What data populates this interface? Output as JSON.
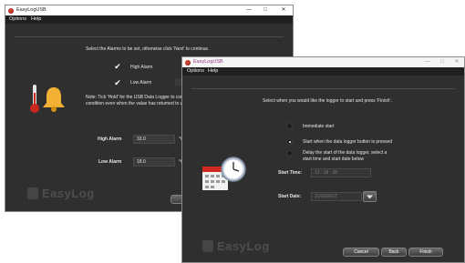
{
  "win1": {
    "title": "EasyLogUSB",
    "menu": [
      "Options",
      "Help"
    ],
    "instruction": "Select the Alarms to be set, otherwise click 'Next' to continue.",
    "high_alarm_label": "High Alarm",
    "low_alarm_label": "Low Alarm",
    "note_line1": "Note: Tick 'Hold' for the USB Data Logger to cont",
    "note_line2": "condition even when the value has returned to w",
    "high_value_label": "High Alarm",
    "high_value": "33.0",
    "high_unit": "°C",
    "low_value_label": "Low Alarm",
    "low_value": "18.0",
    "low_unit": "°C",
    "logo": "EasyLog",
    "controls": {
      "minimize": "—",
      "maximize": "□",
      "close": "✕"
    }
  },
  "win2": {
    "title": "EasyLogUSB",
    "menu": [
      "Options",
      "Help"
    ],
    "instruction": "Select when you would like the logger to start and press 'Finish'.",
    "options": [
      {
        "label": "Immediate start",
        "selected": false
      },
      {
        "label": "Start when the data logger button is pressed",
        "selected": true
      },
      {
        "label_line1": "Delay the start of the data logger, select a",
        "label_line2": "start time and start date below",
        "selected": false
      }
    ],
    "start_time_label": "Start Time:",
    "start_time_value": "12 : 18 : 38",
    "start_date_label": "Start Date:",
    "start_date_value": "21/03/2017",
    "logo": "EasyLog",
    "buttons": {
      "cancel": "Cancel",
      "back": "Back",
      "finish": "Finish"
    },
    "controls": {
      "minimize": "—",
      "maximize": "□",
      "close": "✕"
    }
  },
  "colors": {
    "window_bg": "#2f2f2f",
    "menubar_bg": "#1f1f1f",
    "bell": "#f2b134",
    "thermometer_red": "#c8261f"
  }
}
